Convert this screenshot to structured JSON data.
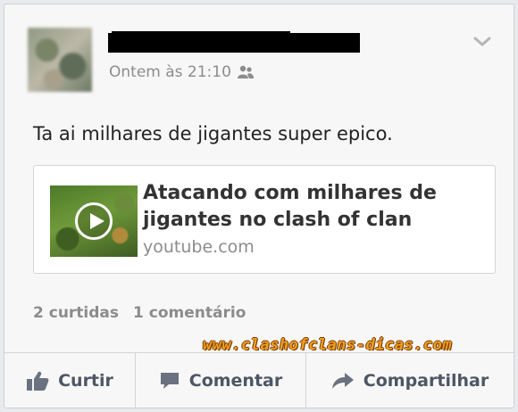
{
  "post": {
    "timestamp": "Ontem às 21:10",
    "text": "Ta ai milhares de jigantes super epico."
  },
  "link": {
    "title": "Atacando com milhares de jigantes no clash of clan",
    "domain": "youtube.com"
  },
  "stats": {
    "likes": "2 curtidas",
    "comments": "1 comentário"
  },
  "watermark": "www.clashofclans-dicas.com",
  "actions": {
    "like": "Curtir",
    "comment": "Comentar",
    "share": "Compartilhar"
  },
  "icons": {
    "privacy": "friends-icon",
    "menu": "chevron-down-icon",
    "like": "thumbs-up-icon",
    "comment": "comment-bubble-icon",
    "share": "share-arrow-icon",
    "play": "play-icon"
  }
}
